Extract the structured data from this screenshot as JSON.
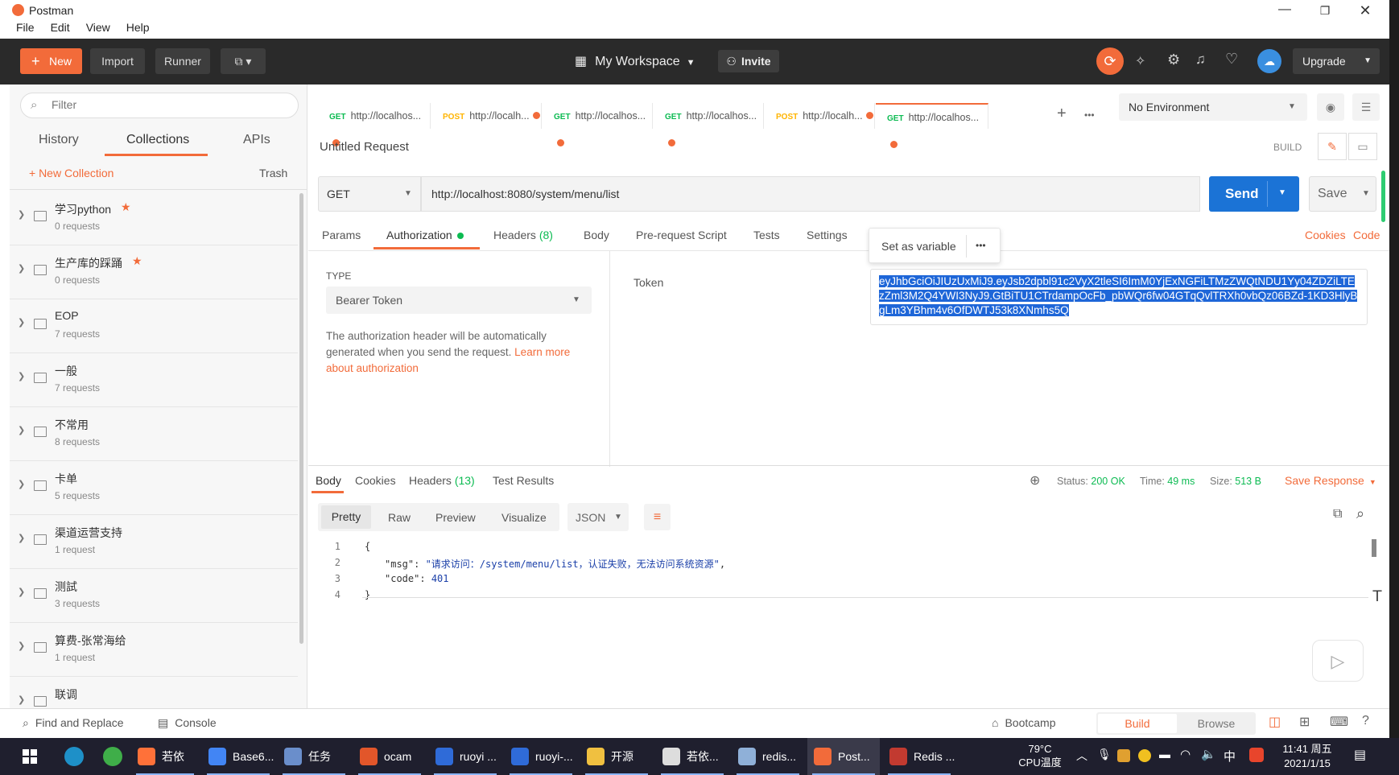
{
  "app": {
    "title": "Postman"
  },
  "menu": [
    "File",
    "Edit",
    "View",
    "Help"
  ],
  "toolbar": {
    "new": "New",
    "import": "Import",
    "runner": "Runner",
    "workspace": "My Workspace",
    "invite": "Invite",
    "upgrade": "Upgrade"
  },
  "sidebar": {
    "filter_placeholder": "Filter",
    "tabs": [
      "History",
      "Collections",
      "APIs"
    ],
    "new_collection": "+ New Collection",
    "trash": "Trash",
    "collections": [
      {
        "name": "学习python",
        "count": "0 requests",
        "starred": true
      },
      {
        "name": "生产库的踩踊",
        "count": "0 requests",
        "starred": true
      },
      {
        "name": "EOP",
        "count": "7 requests",
        "starred": false
      },
      {
        "name": "一般",
        "count": "7 requests",
        "starred": false
      },
      {
        "name": "不常用",
        "count": "8 requests",
        "starred": false
      },
      {
        "name": "卡单",
        "count": "5 requests",
        "starred": false
      },
      {
        "name": "渠道运营支持",
        "count": "1 request",
        "starred": false
      },
      {
        "name": "测試",
        "count": "3 requests",
        "starred": false
      },
      {
        "name": "算费-张常海给",
        "count": "1 request",
        "starred": false
      },
      {
        "name": "联调",
        "count": "",
        "starred": false
      }
    ]
  },
  "tabs": [
    {
      "method": "GET",
      "url": "http://localhos...",
      "color": "#0cbb52"
    },
    {
      "method": "POST",
      "url": "http://localh...",
      "color": "#ffb400"
    },
    {
      "method": "GET",
      "url": "http://localhos...",
      "color": "#0cbb52"
    },
    {
      "method": "GET",
      "url": "http://localhos...",
      "color": "#0cbb52"
    },
    {
      "method": "POST",
      "url": "http://localh...",
      "color": "#ffb400"
    },
    {
      "method": "GET",
      "url": "http://localhos...",
      "color": "#0cbb52"
    }
  ],
  "environment": "No Environment",
  "request": {
    "name": "Untitled Request",
    "build": "BUILD",
    "method": "GET",
    "url": "http://localhost:8080/system/menu/list",
    "send": "Send",
    "save": "Save"
  },
  "req_tabs": {
    "params": "Params",
    "authorization": "Authorization",
    "headers": "Headers",
    "headers_count": "(8)",
    "body": "Body",
    "prerequest": "Pre-request Script",
    "tests": "Tests",
    "settings": "Settings",
    "cookies": "Cookies",
    "code": "Code"
  },
  "popup": {
    "set_variable": "Set as variable",
    "more": "•••"
  },
  "auth": {
    "type_label": "TYPE",
    "type_value": "Bearer Token",
    "desc": "The authorization header will be automatically generated when you send the request. ",
    "learn_more": "Learn more about authorization",
    "token_label": "Token",
    "token_value": "eyJhbGciOiJIUzUxMiJ9.eyJsb2dpbl91c2VyX2tleSI6ImM0YjExNGFiLTMzZWQtNDU1Yy04ZDZiLTEzZml3M2Q4YWI3NyJ9.GtBiTU1CTrdampOcFb_pbWQr6fw04GTqQvlTRXh0vbQz06BZd-1KD3HlyBgLm3YBhm4v6OfDWTJ53k8XNmhs5Q"
  },
  "response": {
    "tabs": {
      "body": "Body",
      "cookies": "Cookies",
      "headers": "Headers",
      "headers_count": "(13)",
      "tests": "Test Results"
    },
    "status_label": "Status:",
    "status_value": "200 OK",
    "time_label": "Time:",
    "time_value": "49 ms",
    "size_label": "Size:",
    "size_value": "513 B",
    "save": "Save Response",
    "views": [
      "Pretty",
      "Raw",
      "Preview",
      "Visualize"
    ],
    "format": "JSON",
    "lines": [
      {
        "n": "1",
        "text": "{"
      },
      {
        "n": "2",
        "key": "\"msg\"",
        "sep": ": ",
        "val": "\"请求访问：/system/menu/list，认证失败，无法访问系统资源\"",
        "tail": ","
      },
      {
        "n": "3",
        "key": "\"code\"",
        "sep": ": ",
        "num": "401"
      },
      {
        "n": "4",
        "text": "}"
      }
    ]
  },
  "statusbar": {
    "find": "Find and Replace",
    "console": "Console",
    "bootcamp": "Bootcamp",
    "build": "Build",
    "browse": "Browse"
  },
  "taskbar": {
    "items": [
      {
        "label": "若依管...",
        "color": "#ff7139"
      },
      {
        "label": "Base6...",
        "color": "#4285f4"
      },
      {
        "label": "任务管...",
        "color": "#6a8ecb"
      },
      {
        "label": "ocam",
        "color": "#e2562a"
      },
      {
        "label": "ruoyi ...",
        "color": "#2f6bd8"
      },
      {
        "label": "ruoyi-...",
        "color": "#2f6bd8"
      },
      {
        "label": "开源项...",
        "color": "#f0c040"
      },
      {
        "label": "若依...",
        "color": "#dddddd"
      },
      {
        "label": "redis...",
        "color": "#8fb0d8"
      },
      {
        "label": "Post...",
        "color": "#f26b3a"
      },
      {
        "label": "Redis ...",
        "color": "#c23a30"
      }
    ],
    "temp": "79°C",
    "temp_label": "CPU温度",
    "ime": "中",
    "time": "11:41 周五",
    "date": "2021/1/15"
  }
}
